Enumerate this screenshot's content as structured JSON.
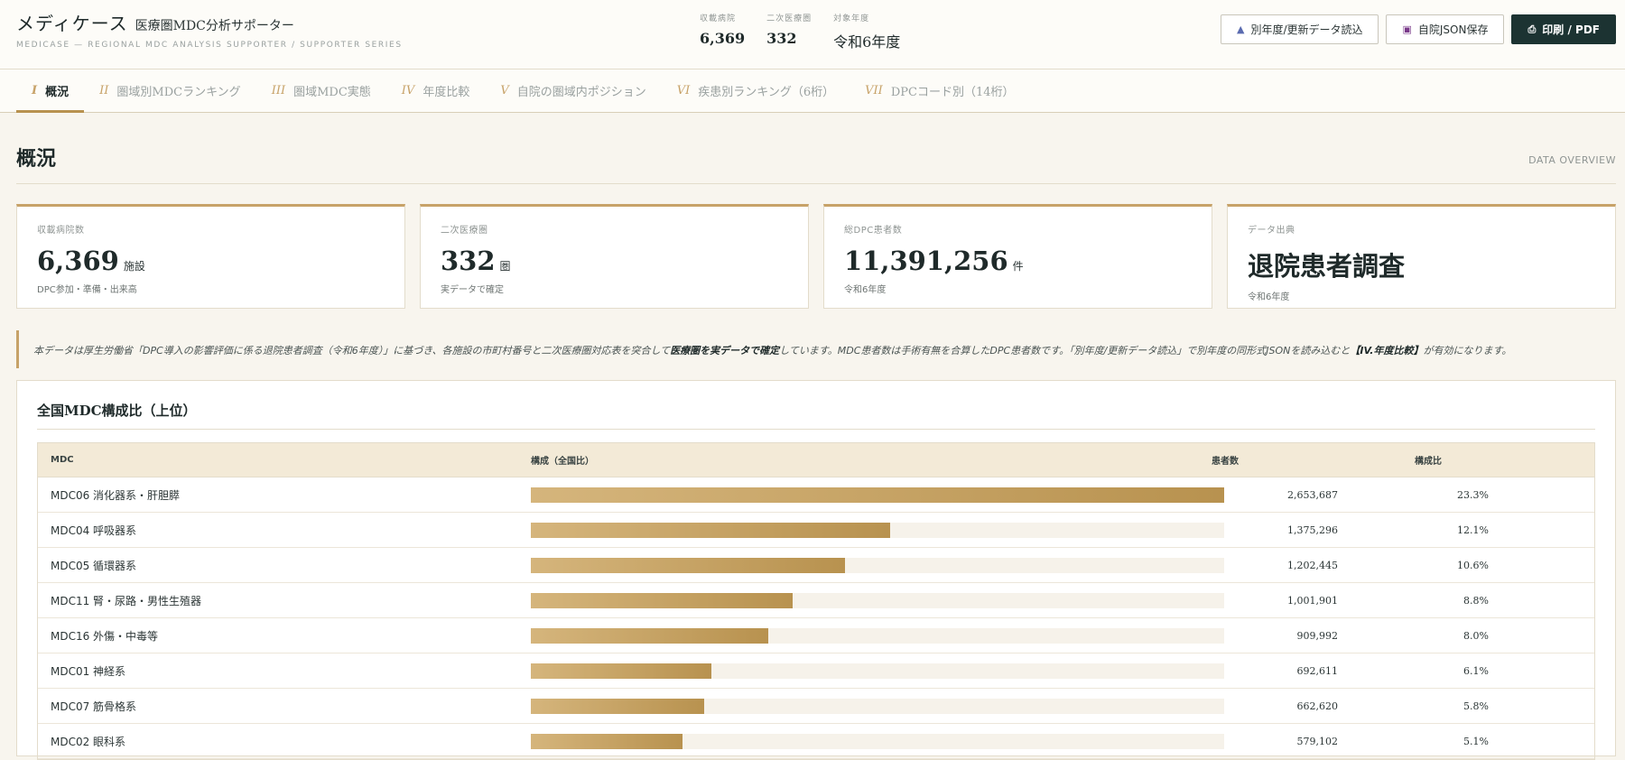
{
  "header": {
    "brand_title": "メディケース",
    "brand_sub": "医療圏MDC分析サポーター",
    "tagline": "MEDICASE — REGIONAL MDC ANALYSIS SUPPORTER / SUPPORTER SERIES",
    "stats": [
      {
        "label": "収載病院",
        "value": "6,369"
      },
      {
        "label": "二次医療圏",
        "value": "332"
      },
      {
        "label": "対象年度",
        "value": "令和6年度"
      }
    ],
    "buttons": {
      "load": "別年度/更新データ読込",
      "save": "自院JSON保存",
      "print": "印刷 / PDF"
    }
  },
  "tabs": [
    {
      "num": "I",
      "label": "概況"
    },
    {
      "num": "II",
      "label": "圏域別MDCランキング"
    },
    {
      "num": "III",
      "label": "圏域MDC実態"
    },
    {
      "num": "IV",
      "label": "年度比較"
    },
    {
      "num": "V",
      "label": "自院の圏域内ポジション"
    },
    {
      "num": "VI",
      "label": "疾患別ランキング（6桁）"
    },
    {
      "num": "VII",
      "label": "DPCコード別（14桁）"
    }
  ],
  "section": {
    "title": "概況",
    "en": "DATA OVERVIEW"
  },
  "cards": [
    {
      "label": "収載病院数",
      "value": "6,369",
      "unit": "施設",
      "note": "DPC参加・準備・出来高"
    },
    {
      "label": "二次医療圏",
      "value": "332",
      "unit": "圏",
      "note": "実データで確定"
    },
    {
      "label": "総DPC患者数",
      "value": "11,391,256",
      "unit": "件",
      "note": "令和6年度"
    },
    {
      "label": "データ出典",
      "value": "退院患者調査",
      "unit": "",
      "note": "令和6年度"
    }
  ],
  "notice": {
    "part1": "本データは厚生労働省「DPC導入の影響評価に係る退院患者調査（令和6年度）」に基づき、各施設の市町村番号と二次医療圏対応表を突合して",
    "bold1": "医療圏を実データで確定",
    "part2": "しています。MDC患者数は手術有無を合算したDPC患者数です。「別年度/更新データ読込」で別年度の同形式JSONを読み込むと",
    "bold2": "【IV.年度比較】",
    "part3": "が有効になります。"
  },
  "panel": {
    "title": "全国MDC構成比（上位）",
    "columns": {
      "mdc": "MDC",
      "bar": "構成（全国比）",
      "count": "患者数",
      "ratio": "構成比"
    }
  },
  "chart_data": {
    "type": "bar",
    "categories": [
      "MDC06 消化器系・肝胆膵",
      "MDC04 呼吸器系",
      "MDC05 循環器系",
      "MDC11 腎・尿路・男性生殖器",
      "MDC16 外傷・中毒等",
      "MDC01 神経系",
      "MDC07 筋骨格系",
      "MDC02 眼科系"
    ],
    "values": [
      2653687,
      1375296,
      1202445,
      1001901,
      909992,
      692611,
      662620,
      579102
    ],
    "value_labels": [
      "2,653,687",
      "1,375,296",
      "1,202,445",
      "1,001,901",
      "909,992",
      "692,611",
      "662,620",
      "579,102"
    ],
    "ratios": [
      "23.3%",
      "12.1%",
      "10.6%",
      "8.8%",
      "8.0%",
      "6.1%",
      "5.8%",
      "5.1%"
    ],
    "xlim": [
      0,
      2653687
    ],
    "colors": {
      "bar_start": "#d5b57c",
      "bar_end": "#b8924f",
      "track": "#f6f2ea"
    }
  }
}
